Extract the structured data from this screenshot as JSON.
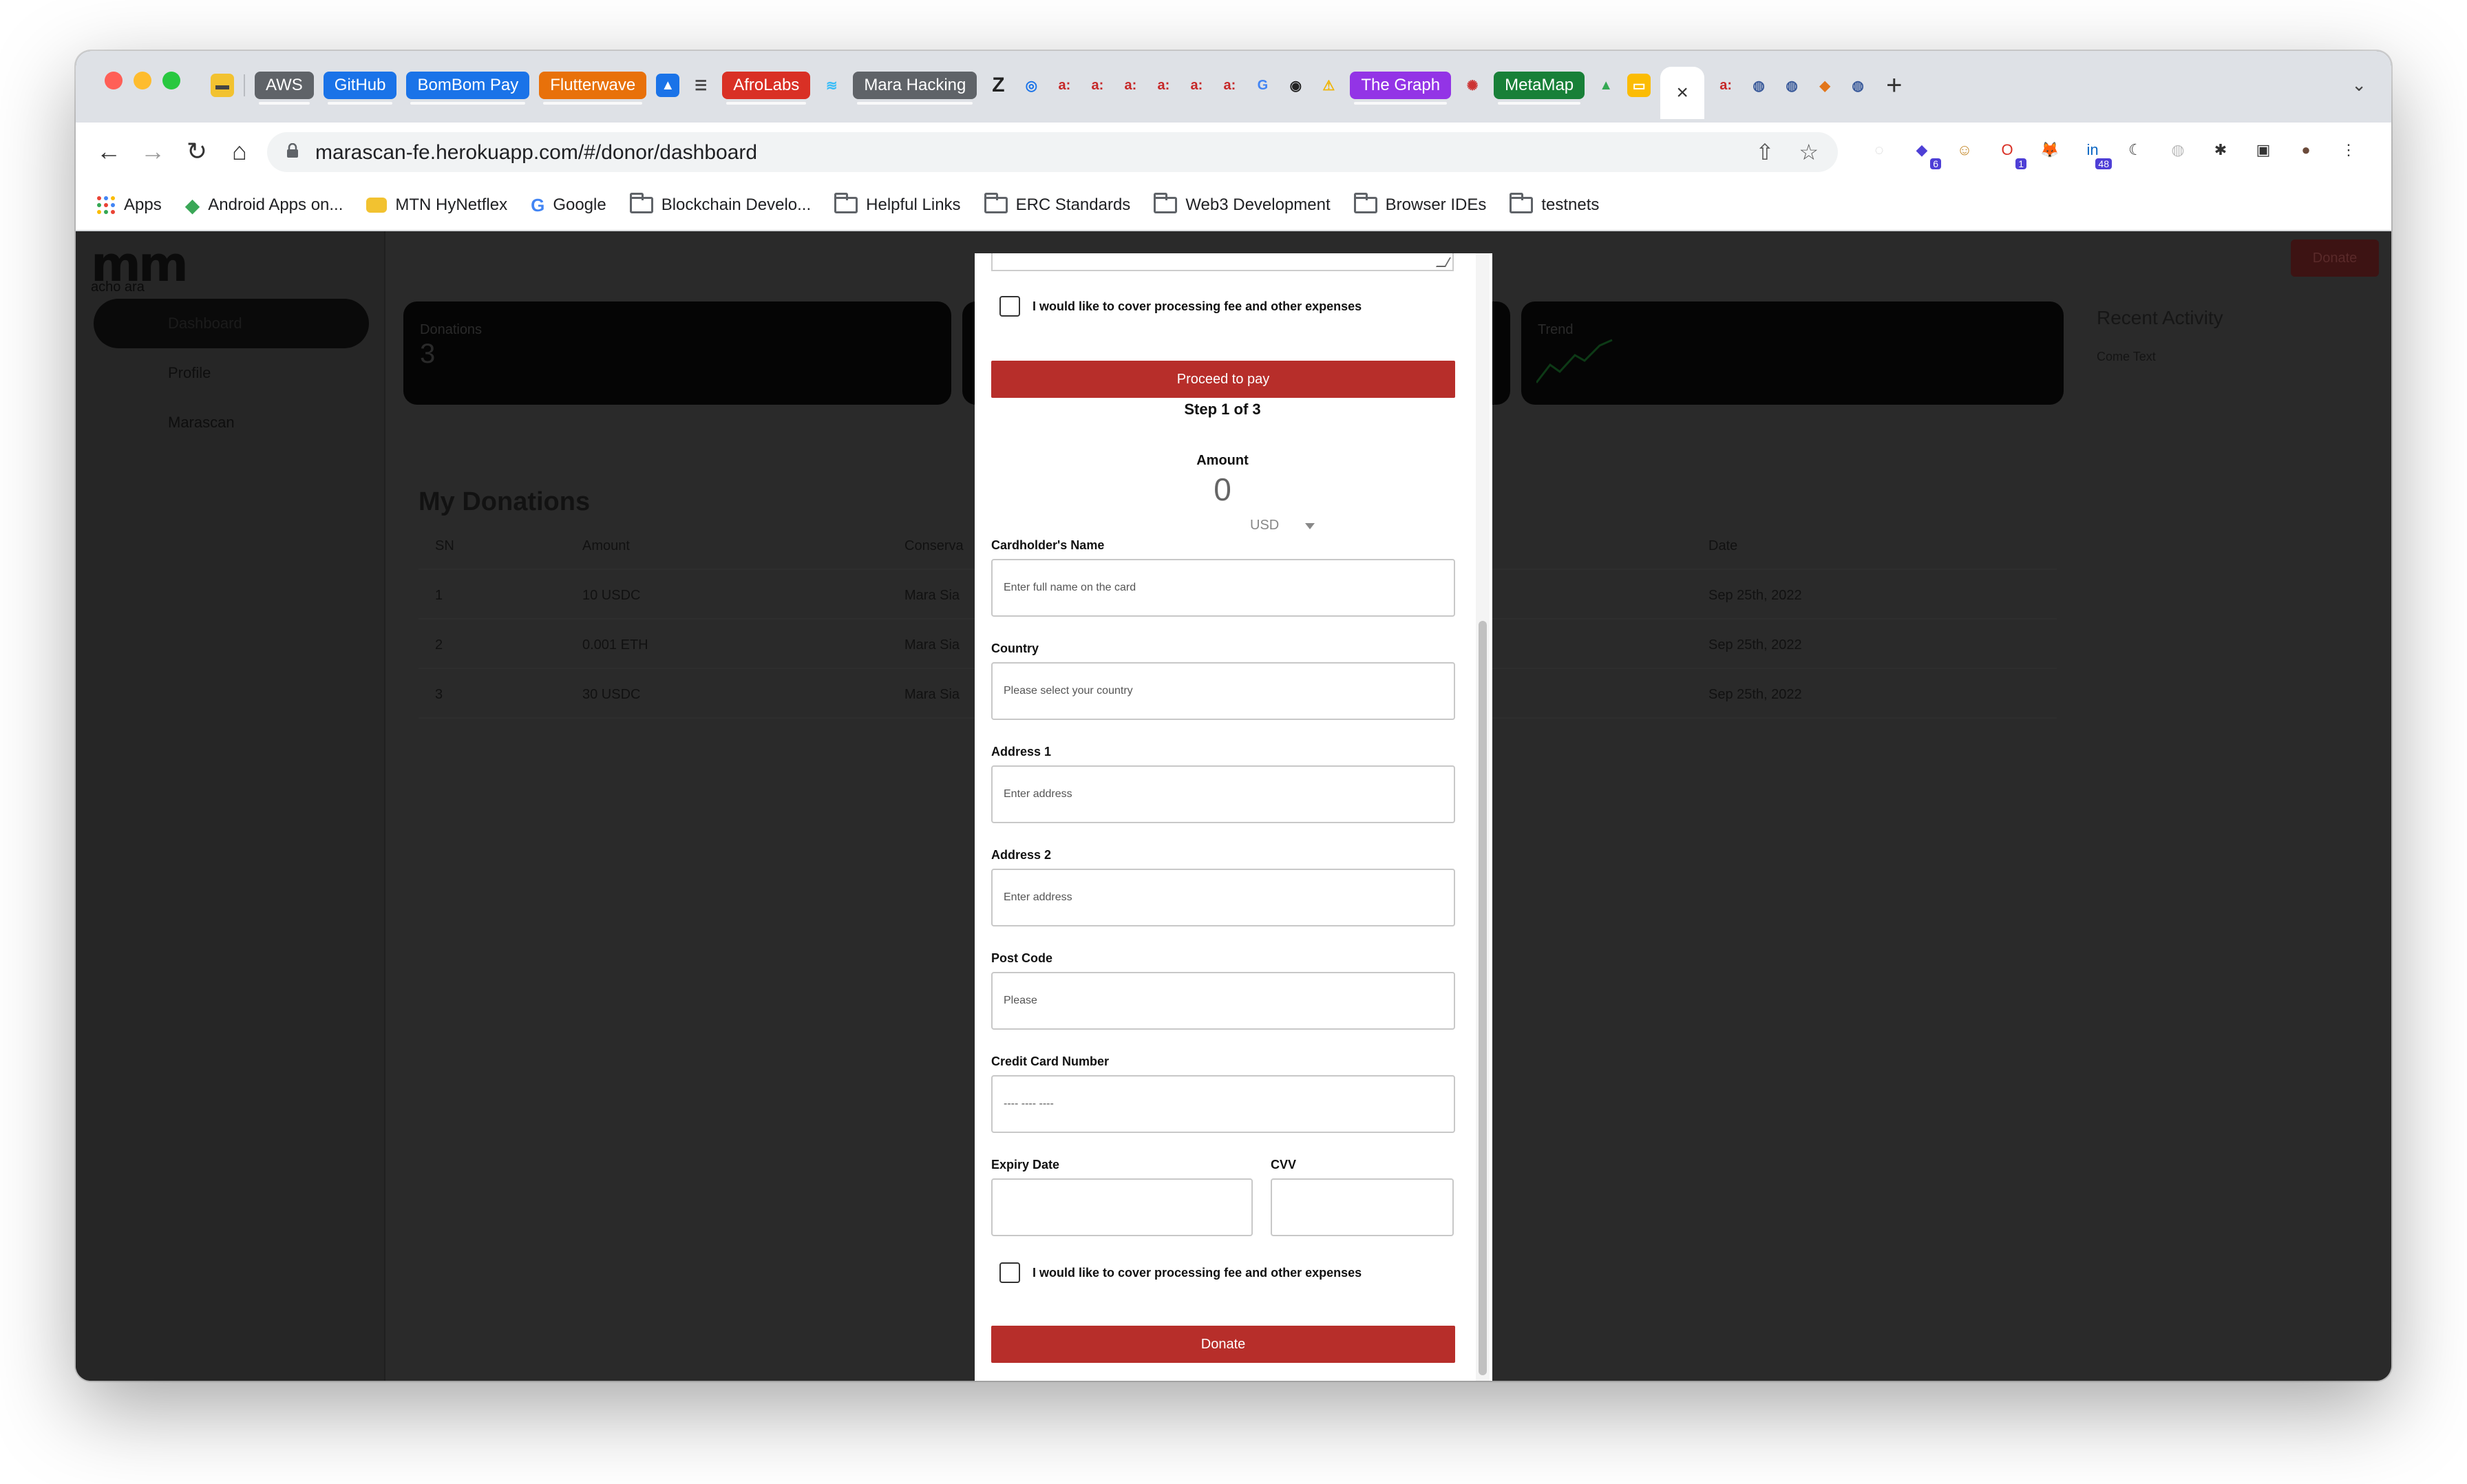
{
  "browser": {
    "tab_chips": [
      {
        "label": "AWS",
        "color": "#5f6368"
      },
      {
        "label": "GitHub",
        "color": "#1a73e8"
      },
      {
        "label": "BomBom Pay",
        "color": "#1a73e8"
      },
      {
        "label": "Flutterwave",
        "color": "#e8710a"
      },
      {
        "label": "AfroLabs",
        "color": "#d93025"
      },
      {
        "label": "Mara Hacking",
        "color": "#5f6368"
      },
      {
        "label": "The Graph",
        "color": "#9334e6"
      },
      {
        "label": "MetaMap",
        "color": "#188038"
      }
    ],
    "fav_glyphs": [
      "≋",
      "Z",
      "◎",
      "a:",
      "a:",
      "a:",
      "a:",
      "a:",
      "a:",
      "G",
      "◉",
      "◎",
      "✉"
    ],
    "active_tab_close": "×",
    "new_tab": "+",
    "tab_menu": "⌄",
    "nav": {
      "back": "←",
      "forward": "→",
      "reload": "↻",
      "home": "⌂"
    },
    "url": "marascan-fe.herokuapp.com/#/donor/dashboard",
    "url_share": "⇧",
    "url_star": "☆",
    "extensions": [
      {
        "glyph": "◌",
        "color": "#d0d0d0"
      },
      {
        "glyph": "◆",
        "color": "#4e3fd6",
        "badge": "6"
      },
      {
        "glyph": "☺",
        "color": "#c58a2c"
      },
      {
        "glyph": "O",
        "color": "#d93025",
        "badge": "1"
      },
      {
        "glyph": "🦊",
        "color": "#f0a040"
      },
      {
        "glyph": "in",
        "color": "#0a66c2",
        "badge": "48"
      },
      {
        "glyph": "☾",
        "color": "#333333"
      },
      {
        "glyph": "◍",
        "color": "#bbbbbb"
      },
      {
        "glyph": "✱",
        "color": "#333333"
      },
      {
        "glyph": "▣",
        "color": "#333333"
      },
      {
        "glyph": "●",
        "color": "#6b4a3a"
      },
      {
        "glyph": "⋮",
        "color": "#ffffff"
      }
    ],
    "bookmarks": [
      {
        "label": "Apps",
        "icon": "apps-grid-icon"
      },
      {
        "label": "Android Apps on...",
        "icon": "play-store-icon"
      },
      {
        "label": "MTN HyNetflex",
        "icon": "mtn-icon"
      },
      {
        "label": "Google",
        "icon": "google-icon"
      },
      {
        "label": "Blockchain Develo...",
        "icon": "folder-icon"
      },
      {
        "label": "Helpful Links",
        "icon": "folder-icon"
      },
      {
        "label": "ERC Standards",
        "icon": "folder-icon"
      },
      {
        "label": "Web3 Development",
        "icon": "folder-icon"
      },
      {
        "label": "Browser IDEs",
        "icon": "folder-icon"
      },
      {
        "label": "testnets",
        "icon": "folder-icon"
      }
    ]
  },
  "app": {
    "logo_main": "mm",
    "logo_sub": "acho ara",
    "top_donate": "Donate",
    "sidebar": [
      "Dashboard",
      "Profile",
      "Marascan"
    ],
    "cards": [
      {
        "title": "Donations",
        "value": "3"
      },
      {
        "title": "",
        "value": ""
      },
      {
        "title": "Trend",
        "value": ""
      }
    ],
    "recent_activity_title": "Recent Activity",
    "recent_activity_text": "Come Text",
    "my_donations_title": "My Donations",
    "table": {
      "headers": [
        "SN",
        "Amount",
        "Conserva",
        "Date"
      ],
      "rows": [
        [
          "1",
          "10 USDC",
          "Mara Sia",
          "Sep 25th, 2022"
        ],
        [
          "2",
          "0.001 ETH",
          "Mara Sia",
          "Sep 25th, 2022"
        ],
        [
          "3",
          "30 USDC",
          "Mara Sia",
          "Sep 25th, 2022"
        ]
      ]
    }
  },
  "modal": {
    "cover_fee_label": "I would like to cover processing fee and other expenses",
    "proceed_label": "Proceed to pay",
    "step_label": "Step 1 of 3",
    "amount_label": "Amount",
    "amount_value": "0",
    "currency": "USD",
    "fields": {
      "cardholder": {
        "label": "Cardholder's Name",
        "placeholder": "Enter full name on the card"
      },
      "country": {
        "label": "Country",
        "placeholder": "Please select your country"
      },
      "address1": {
        "label": "Address 1",
        "placeholder": "Enter address"
      },
      "address2": {
        "label": "Address 2",
        "placeholder": "Enter address"
      },
      "postcode": {
        "label": "Post Code",
        "placeholder": "Please"
      },
      "card_number": {
        "label": "Credit Card Number",
        "placeholder": "---- ---- ----"
      },
      "expiry": {
        "label": "Expiry Date",
        "placeholder": ""
      },
      "cvv": {
        "label": "CVV",
        "placeholder": ""
      }
    },
    "cover_fee_label_bottom": "I would like to cover processing fee and other expenses",
    "donate_label": "Donate"
  }
}
